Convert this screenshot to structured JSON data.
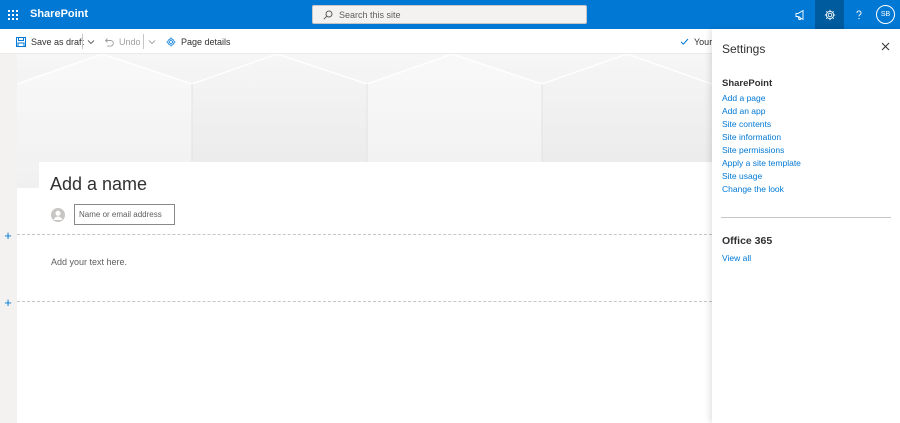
{
  "suite": {
    "app_name": "SharePoint",
    "search_placeholder": "Search this site",
    "avatar_initials": "SB",
    "icons": [
      "waffle-icon",
      "megaphone-icon",
      "gear-icon",
      "help-icon"
    ]
  },
  "command_bar": {
    "save_draft": "Save as draft",
    "undo": "Undo",
    "page_details": "Page details",
    "status": "Your"
  },
  "page": {
    "title_placeholder": "Add a name",
    "author_placeholder": "Name or email address",
    "text_placeholder": "Add your text here."
  },
  "settings": {
    "title": "Settings",
    "sharepoint_heading": "SharePoint",
    "links": [
      "Add a page",
      "Add an app",
      "Site contents",
      "Site information",
      "Site permissions",
      "Apply a site template",
      "Site usage",
      "Change the look"
    ],
    "office_heading": "Office 365",
    "view_all": "View all"
  },
  "colors": {
    "brand": "#0078d4",
    "active_tab": "#005a9e",
    "link": "#0078d4"
  }
}
